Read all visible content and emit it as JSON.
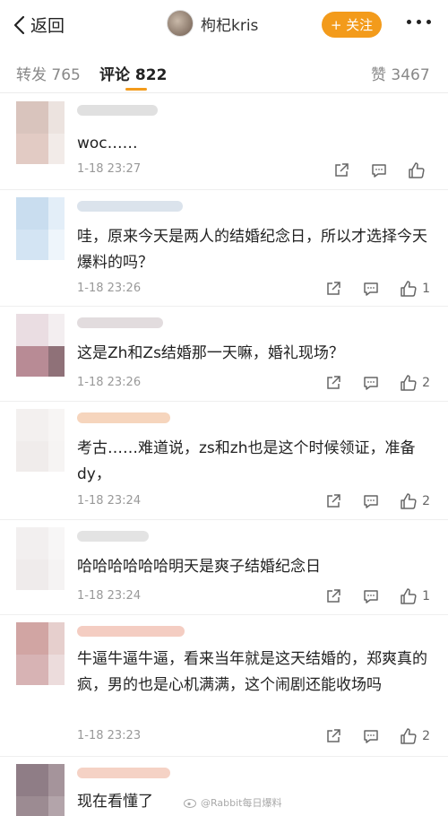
{
  "header": {
    "back_label": "返回",
    "profile_name": "枸杞kris",
    "follow_label": "+ 关注"
  },
  "tabs": {
    "repost": "转发 765",
    "comment": "评论 822",
    "like": "赞 3467"
  },
  "comments": [
    {
      "text": "woc……",
      "time": "1-18 23:27",
      "likes": ""
    },
    {
      "text": "哇，原来今天是两人的结婚纪念日，所以才选择今天爆料的吗？",
      "time": "1-18 23:26",
      "likes": "1"
    },
    {
      "text": "这是Zh和Zs结婚那一天嘛，婚礼现场？",
      "time": "1-18 23:26",
      "likes": "2"
    },
    {
      "text": "考古……难道说，zs和zh也是这个时候领证，准备dy，",
      "time": "1-18 23:24",
      "likes": "2"
    },
    {
      "text": "哈哈哈哈哈哈明天是爽子结婚纪念日",
      "time": "1-18 23:24",
      "likes": "1"
    },
    {
      "text": "牛逼牛逼牛逼，看来当年就是这天结婚的，郑爽真的疯，男的也是心机满满，这个闹剧还能收场吗",
      "time": "1-18 23:23",
      "likes": "2"
    },
    {
      "text": "现在看懂了",
      "time": "",
      "likes": ""
    }
  ],
  "watermark": "@Rabbit每日爆料",
  "colors": {
    "accent": "#f39b1b",
    "avatar_palettes": [
      [
        "#d9c4bd",
        "#ece3df",
        "#e2cbc4",
        "#f2ebe8"
      ],
      [
        "#c9ddef",
        "#e3eef8",
        "#d3e4f3",
        "#eef5fb"
      ],
      [
        "#eadde2",
        "#f3eef0",
        "#b88b95",
        "#8f7178"
      ],
      [
        "#f3f0ef",
        "#f7f5f4",
        "#f0eceb",
        "#f6f4f3"
      ],
      [
        "#f2efef",
        "#f7f6f6",
        "#efebeb",
        "#f5f3f3"
      ],
      [
        "#d1a5a3",
        "#e6cfcd",
        "#d7b3b4",
        "#ecdcdc"
      ],
      [
        "#8f7d86",
        "#a5949b",
        "#9c8b92",
        "#b3a4aa"
      ]
    ],
    "name_blurs": [
      "#d5d5d5",
      "#cfd9e5",
      "#d8d0d3",
      "#f3c7a7",
      "#d9d9d9",
      "#f0bcae",
      "#f2c3b1"
    ]
  }
}
